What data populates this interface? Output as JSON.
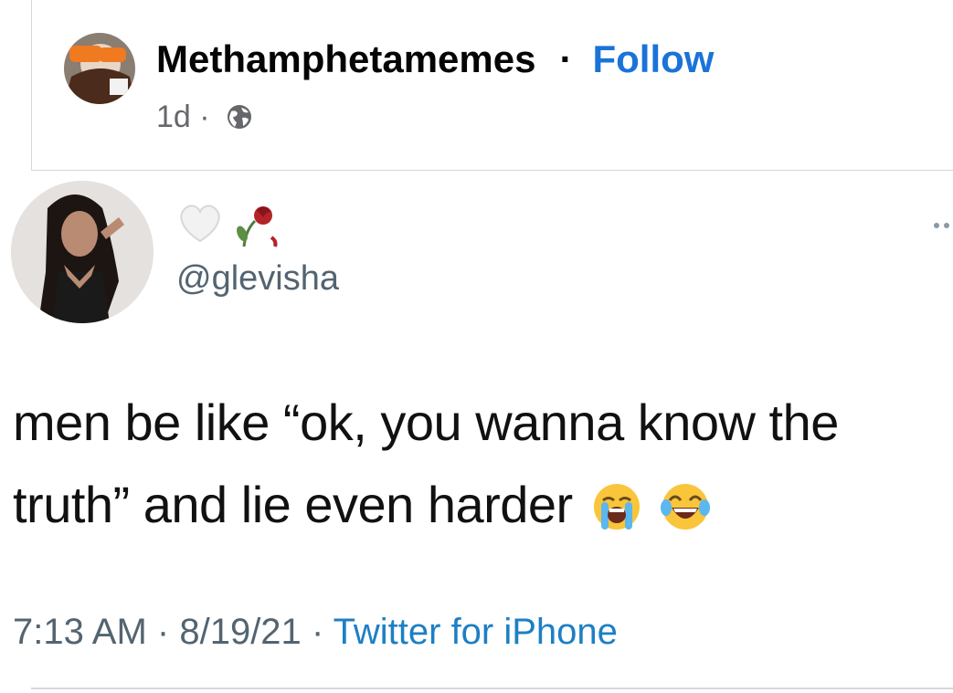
{
  "facebook_post": {
    "page_name": "Methamphetamemes",
    "separator": "·",
    "follow_label": "Follow",
    "time_ago": "1d",
    "meta_separator": "·",
    "privacy_icon": "globe-icon"
  },
  "tweet": {
    "name_emojis": [
      "white-heart-icon",
      "wilted-rose-icon"
    ],
    "handle": "@glevisha",
    "text_line1": "men be like “ok, you wanna know the",
    "text_line2": "truth” and lie even harder",
    "trailing_emojis": [
      "loudly-crying-face-icon",
      "face-with-tears-of-joy-icon"
    ],
    "time": "7:13 AM",
    "date": "8/19/21",
    "separator": "·",
    "source": "Twitter for iPhone",
    "more_icon": "more-options-icon"
  },
  "colors": {
    "follow_blue": "#1a73d9",
    "source_blue": "#1d7fc4",
    "meta_gray": "#65676b",
    "text_black": "#111111"
  }
}
